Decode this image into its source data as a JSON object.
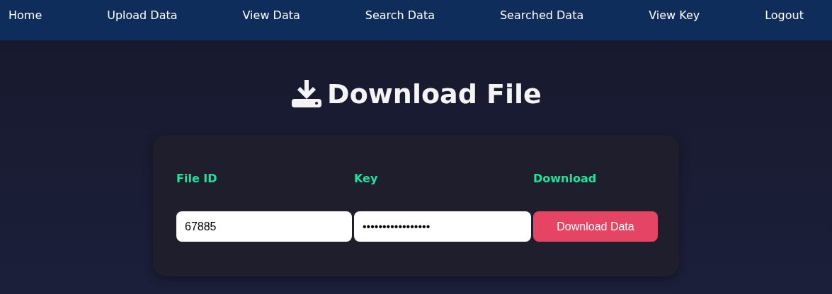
{
  "nav": [
    {
      "label": "Home"
    },
    {
      "label": "Upload Data"
    },
    {
      "label": "View Data"
    },
    {
      "label": "Search Data"
    },
    {
      "label": "Searched Data"
    },
    {
      "label": "View Key"
    },
    {
      "label": "Logout"
    }
  ],
  "title": "Download File",
  "form": {
    "columns": [
      "File ID",
      "Key",
      "Download"
    ],
    "file_id": {
      "value": "67885"
    },
    "key": {
      "value": "•••••••••••••••••"
    },
    "button": "Download Data"
  }
}
